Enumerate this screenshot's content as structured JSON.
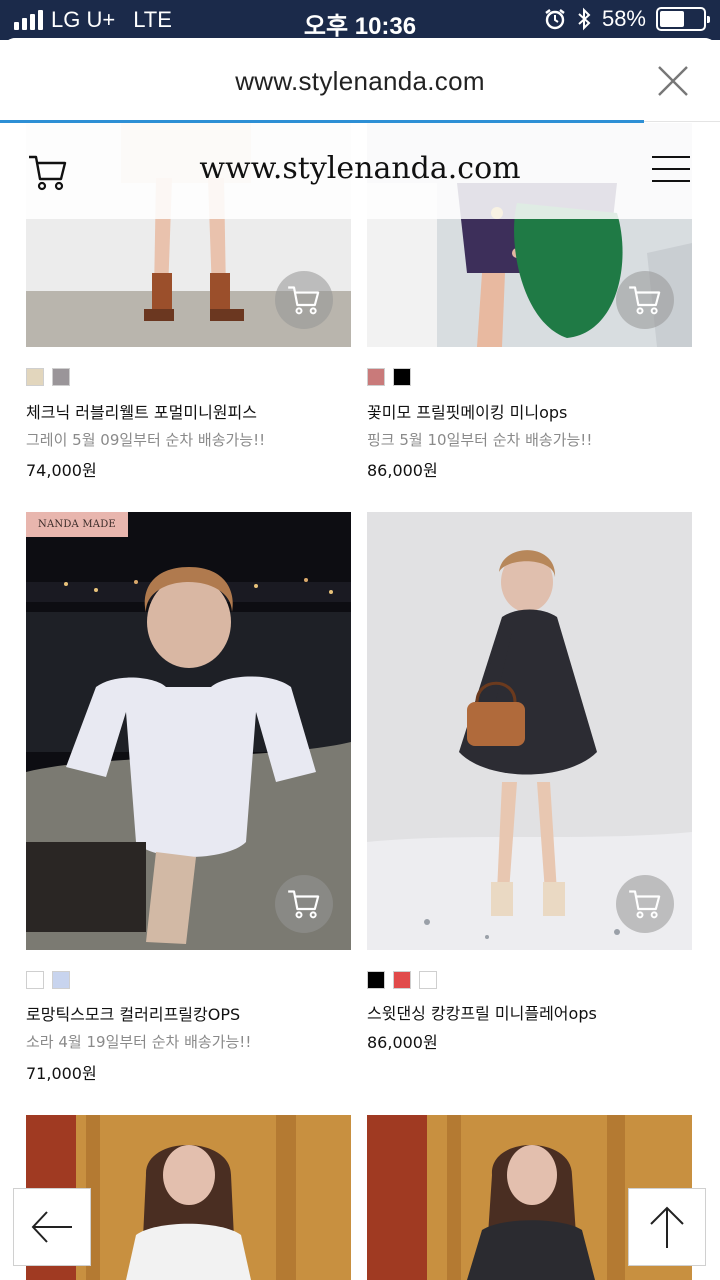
{
  "status_bar": {
    "carrier": "LG U+",
    "network": "LTE",
    "time": "오후 10:36",
    "battery": "58%",
    "battery_level": 0.58
  },
  "browser": {
    "url": "www.stylenanda.com"
  },
  "site": {
    "title": "www.stylenanda.com"
  },
  "products": [
    {
      "name": "체크닉 러블리웰트 포멀미니원피스",
      "note": "그레이 5월 09일부터 순차 배송가능!!",
      "price": "74,000원",
      "swatches": [
        "#e2d6bd",
        "#9a9599"
      ]
    },
    {
      "name": "꽃미모 프릴핏메이킹 미니ops",
      "note": "핑크 5월 10일부터 순차 배송가능!!",
      "price": "86,000원",
      "swatches": [
        "#c97a7a",
        "#000000"
      ]
    },
    {
      "badge": "NANDA MADE",
      "name": "로망틱스모크 컬러리프릴캉OPS",
      "note": "소라 4월 19일부터 순차 배송가능!!",
      "price": "71,000원",
      "swatches": [
        "#ffffff",
        "#c8d4ee"
      ]
    },
    {
      "name": "스윗댄싱 캉캉프릴 미니플레어ops",
      "note": "",
      "price": "86,000원",
      "swatches": [
        "#000000",
        "#e14a4a",
        "#ffffff"
      ]
    }
  ],
  "colors": {
    "status_bar_bg": "#1b2a4a",
    "progress": "#2d8fd5",
    "badge_bg": "#e8b6ae"
  },
  "icons": [
    "cart-icon",
    "close-icon",
    "menu-icon",
    "back-arrow-icon",
    "scroll-top-icon",
    "signal-icon",
    "alarm-icon",
    "bluetooth-icon",
    "battery-icon"
  ]
}
